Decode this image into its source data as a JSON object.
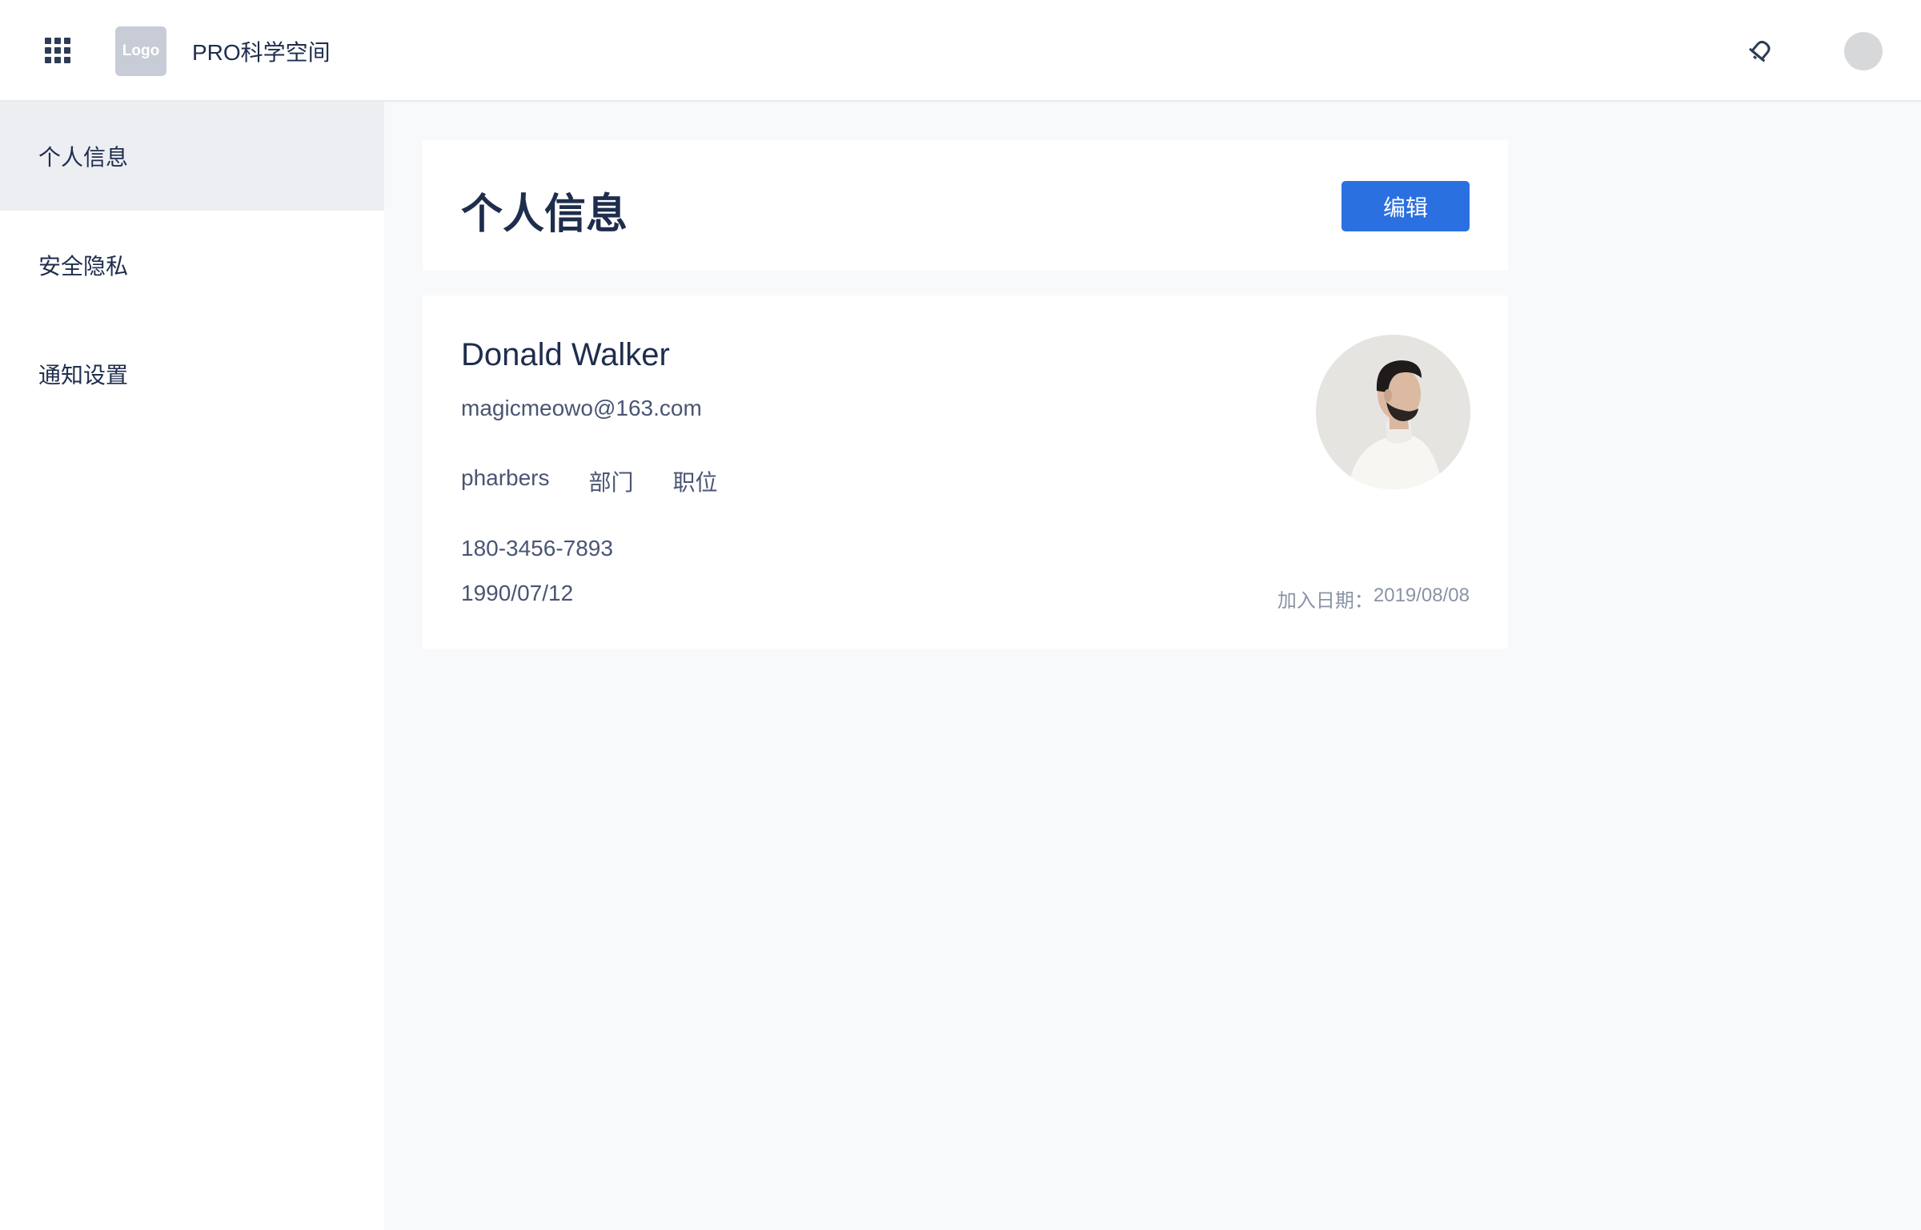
{
  "header": {
    "logo_text": "Logo",
    "app_title": "PRO科学空间",
    "icons": [
      "apps-grid-icon",
      "bell-icon",
      "user-avatar"
    ]
  },
  "sidebar": {
    "items": [
      {
        "label": "个人信息",
        "active": true
      },
      {
        "label": "安全隐私",
        "active": false
      },
      {
        "label": "通知设置",
        "active": false
      }
    ]
  },
  "main": {
    "title": "个人信息",
    "edit_label": "编辑"
  },
  "profile": {
    "name": "Donald Walker",
    "email": "magicmeowo@163.com",
    "company": "pharbers",
    "department": "部门",
    "position": "职位",
    "phone": "180-3456-7893",
    "birthday": "1990/07/12",
    "joined_label": "加入日期：",
    "joined_date": "2019/08/08"
  },
  "colors": {
    "accent": "#2b70e0",
    "text": "#1f2d4d",
    "muted": "#8a93a6",
    "page_bg": "#f8f9fb",
    "active_bg": "#eceef2"
  }
}
